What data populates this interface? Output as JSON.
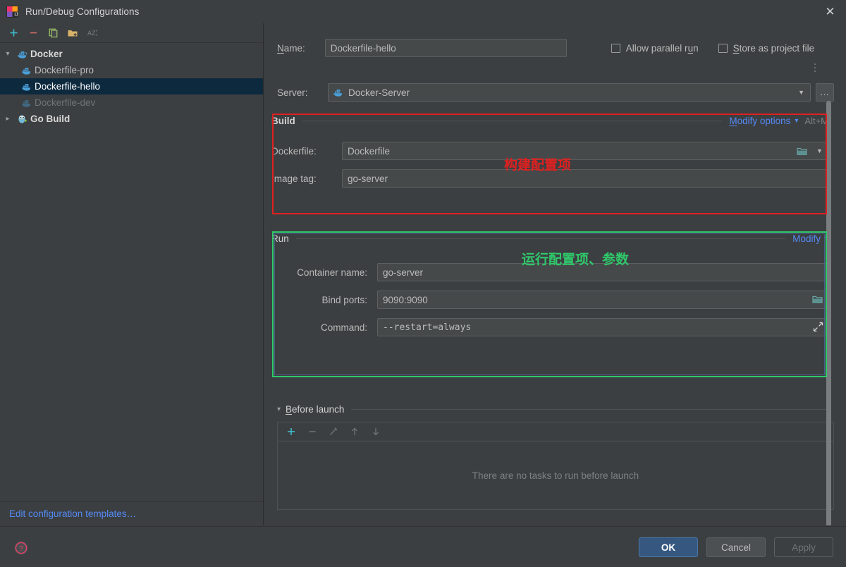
{
  "window": {
    "title": "Run/Debug Configurations",
    "app_icon": "intellij-idea-icon",
    "close_label": "✕"
  },
  "sidebar": {
    "toolbar": [
      {
        "name": "add-configuration-button",
        "glyph": "+",
        "color": "#3fb5c4"
      },
      {
        "name": "remove-configuration-button",
        "glyph": "−",
        "color": "#cf6a6a"
      },
      {
        "name": "copy-configuration-button",
        "glyph": "copy-icon",
        "color": "#9ec36b"
      },
      {
        "name": "new-folder-button",
        "glyph": "folder-plus-icon",
        "color": "#d9b26a"
      },
      {
        "name": "sort-configurations-button",
        "glyph": "AZ",
        "color": "#7d8184"
      }
    ],
    "tree": [
      {
        "label": "Docker",
        "type": "group",
        "expanded": true,
        "icon": "docker-icon",
        "selected": false,
        "dim": false
      },
      {
        "label": "Dockerfile-pro",
        "type": "item",
        "icon": "docker-icon",
        "selected": false,
        "dim": false
      },
      {
        "label": "Dockerfile-hello",
        "type": "item",
        "icon": "docker-icon",
        "selected": true,
        "dim": false
      },
      {
        "label": "Dockerfile-dev",
        "type": "item",
        "icon": "docker-icon",
        "selected": false,
        "dim": true
      },
      {
        "label": "Go Build",
        "type": "group",
        "expanded": false,
        "icon": "go-gopher-icon",
        "selected": false,
        "dim": false
      }
    ],
    "edit_templates_link": "Edit configuration templates…"
  },
  "form": {
    "name_label": "Name:",
    "name_label_mnemonic": "N",
    "name_value": "Dockerfile-hello",
    "allow_parallel_run": {
      "label": "Allow parallel run",
      "mnemonic": "u",
      "checked": false
    },
    "store_as_project_file": {
      "label": "Store as project file",
      "mnemonic": "S",
      "checked": false
    },
    "server_label": "Server:",
    "server_value": "Docker-Server",
    "server_icon": "docker-icon",
    "server_browse_label": "…"
  },
  "build_section": {
    "title": "Build",
    "modify_link": "Modify options",
    "modify_mnemonic": "M",
    "shortcut_hint": "Alt+M",
    "dockerfile_label": "Dockerfile:",
    "dockerfile_value": "Dockerfile",
    "dockerfile_browse_icon": "folder-icon",
    "dockerfile_dropdown_icon": "chevron-down-icon",
    "image_tag_label": "Image tag:",
    "image_tag_value": "go-server",
    "border_color": "#e02020"
  },
  "run_section": {
    "title": "Run",
    "modify_link": "Modify",
    "container_name_label": "Container name:",
    "container_name_value": "go-server",
    "bind_ports_label": "Bind ports:",
    "bind_ports_value": "9090:9090",
    "bind_ports_browse_icon": "folder-icon",
    "command_label": "Command:",
    "command_value": "--restart=always",
    "command_expand_icon": "expand-icon",
    "border_color": "#2fc96b",
    "inner_border_color": "#4a5a8a"
  },
  "annotations": [
    {
      "text": "构建配置项",
      "color": "#e02020",
      "name": "annotation-build-config"
    },
    {
      "text": "运行配置项、参数",
      "color": "#2fc96b",
      "name": "annotation-run-config"
    }
  ],
  "before_launch": {
    "title": "Before launch",
    "mnemonic": "B",
    "expanded": true,
    "toolbar": [
      {
        "name": "add-task-button",
        "glyph": "+",
        "color": "#3fb5c4",
        "enabled": true
      },
      {
        "name": "remove-task-button",
        "glyph": "−",
        "color": "#6f7376",
        "enabled": false
      },
      {
        "name": "edit-task-button",
        "glyph": "pencil-icon",
        "color": "#6f7376",
        "enabled": false
      },
      {
        "name": "move-up-button",
        "glyph": "↑",
        "color": "#6f7376",
        "enabled": false
      },
      {
        "name": "move-down-button",
        "glyph": "↓",
        "color": "#6f7376",
        "enabled": false
      }
    ],
    "empty_text": "There are no tasks to run before launch"
  },
  "footer": {
    "help_icon": "help-circle-icon",
    "ok_label": "OK",
    "cancel_label": "Cancel",
    "apply_label": "Apply",
    "apply_enabled": false,
    "ok_color": "#365880"
  }
}
